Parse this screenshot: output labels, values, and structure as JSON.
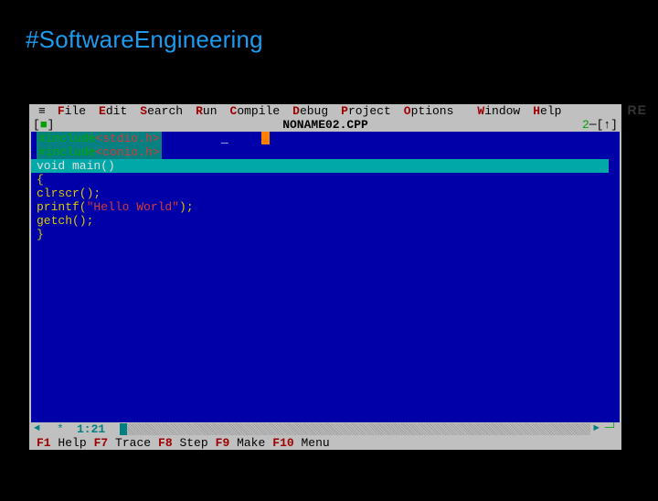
{
  "hashtag": "#SoftwareEngineering",
  "watermark": "RE",
  "menu": {
    "items": [
      {
        "hot": "F",
        "rest": "ile"
      },
      {
        "hot": "E",
        "rest": "dit"
      },
      {
        "hot": "S",
        "rest": "earch"
      },
      {
        "hot": "R",
        "rest": "un"
      },
      {
        "hot": "C",
        "rest": "ompile"
      },
      {
        "hot": "D",
        "rest": "ebug"
      },
      {
        "hot": "P",
        "rest": "roject"
      },
      {
        "hot": "O",
        "rest": "ptions"
      },
      {
        "hot": "W",
        "rest": "indow"
      },
      {
        "hot": "H",
        "rest": "elp"
      }
    ]
  },
  "title": {
    "close_glyph_l": "[",
    "close_glyph_m": "■",
    "close_glyph_r": "]",
    "filename": "NONAME02.CPP",
    "right": "2",
    "right_arrows": "─[↑]"
  },
  "code": {
    "include1_pre": "#include",
    "include1_hdr": "<stdio.h>",
    "include2_pre": "#include",
    "include2_hdr": "<conio.h>",
    "decl": "void main()",
    "brace_open": "{",
    "l1": "clrscr();",
    "l2a": "printf(",
    "l2s": "\"Hello World\"",
    "l2b": ");",
    "l3": "getch();",
    "brace_close": "}"
  },
  "status": {
    "star": "*",
    "pos": "1:21"
  },
  "help": {
    "items": [
      {
        "key": "F1",
        "label": " Help"
      },
      {
        "key": "F7",
        "label": " Trace"
      },
      {
        "key": "F8",
        "label": " Step"
      },
      {
        "key": "F9",
        "label": " Make"
      },
      {
        "key": "F10",
        "label": " Menu"
      }
    ]
  }
}
